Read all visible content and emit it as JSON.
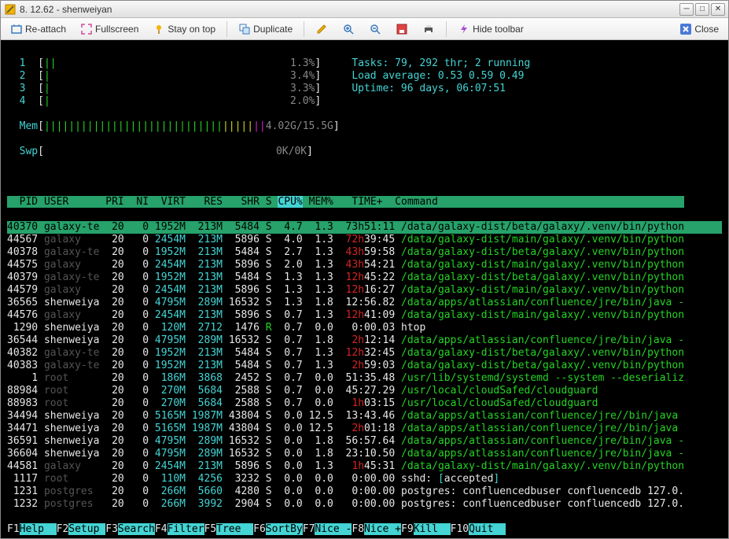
{
  "window": {
    "title": "8. 12.62 - shenweiyan"
  },
  "toolbar": {
    "reattach": "Re-attach",
    "fullscreen": "Fullscreen",
    "stayontop": "Stay on top",
    "duplicate": "Duplicate",
    "hide": "Hide toolbar",
    "close": "Close"
  },
  "cpus": [
    {
      "id": "1",
      "pct": "1.3%"
    },
    {
      "id": "2",
      "pct": "3.4%"
    },
    {
      "id": "3",
      "pct": "3.3%"
    },
    {
      "id": "4",
      "pct": "2.0%"
    }
  ],
  "mem": {
    "label": "Mem",
    "text": "4.02G/15.5G"
  },
  "swp": {
    "label": "Swp",
    "text": "0K/0K"
  },
  "sysinfo": {
    "tasks": "Tasks: 79, 292 thr; 2 running",
    "load": "Load average: 0.53 0.59 0.49",
    "uptime": "Uptime: 96 days, 06:07:51"
  },
  "header": {
    "pid": "PID",
    "user": "USER",
    "pri": "PRI",
    "ni": "NI",
    "virt": "VIRT",
    "res": "RES",
    "shr": "SHR",
    "s": "S",
    "cpu": "CPU%",
    "mem": "MEM%",
    "time": "TIME+",
    "cmd": "Command"
  },
  "rows": [
    {
      "pid": "40370",
      "user": "galaxy-te",
      "uc": "white",
      "pri": "20",
      "ni": "0",
      "virt": "1952M",
      "res": "213M",
      "shr": "5484",
      "s": "S",
      "cpu": "4.7",
      "mem": "1.3",
      "t1": "73h",
      "t2": "51:11",
      "cmd": "/data/galaxy-dist/beta/galaxy/.venv/bin/python",
      "sel": true
    },
    {
      "pid": "44567",
      "user": "galaxy",
      "uc": "dimgrey",
      "pri": "20",
      "ni": "0",
      "virt": "2454M",
      "res": "213M",
      "shr": "5896",
      "s": "S",
      "cpu": "4.0",
      "mem": "1.3",
      "t1": "72h",
      "t2": "39:45",
      "tc": "red",
      "cmd": "/data/galaxy-dist/main/galaxy/.venv/bin/python"
    },
    {
      "pid": "40378",
      "user": "galaxy-te",
      "uc": "dimgrey",
      "pri": "20",
      "ni": "0",
      "virt": "1952M",
      "res": "213M",
      "shr": "5484",
      "s": "S",
      "cpu": "2.7",
      "mem": "1.3",
      "t1": "43h",
      "t2": "59:58",
      "tc": "red",
      "cmd": "/data/galaxy-dist/beta/galaxy/.venv/bin/python"
    },
    {
      "pid": "44575",
      "user": "galaxy",
      "uc": "dimgrey",
      "pri": "20",
      "ni": "0",
      "virt": "2454M",
      "res": "213M",
      "shr": "5896",
      "s": "S",
      "cpu": "2.0",
      "mem": "1.3",
      "t1": "43h",
      "t2": "54:21",
      "tc": "red",
      "cmd": "/data/galaxy-dist/main/galaxy/.venv/bin/python"
    },
    {
      "pid": "40379",
      "user": "galaxy-te",
      "uc": "dimgrey",
      "pri": "20",
      "ni": "0",
      "virt": "1952M",
      "res": "213M",
      "shr": "5484",
      "s": "S",
      "cpu": "1.3",
      "mem": "1.3",
      "t1": "12h",
      "t2": "45:22",
      "tc": "red",
      "cmd": "/data/galaxy-dist/beta/galaxy/.venv/bin/python"
    },
    {
      "pid": "44579",
      "user": "galaxy",
      "uc": "dimgrey",
      "pri": "20",
      "ni": "0",
      "virt": "2454M",
      "res": "213M",
      "shr": "5896",
      "s": "S",
      "cpu": "1.3",
      "mem": "1.3",
      "t1": "12h",
      "t2": "16:27",
      "tc": "red",
      "cmd": "/data/galaxy-dist/main/galaxy/.venv/bin/python"
    },
    {
      "pid": "36565",
      "user": "shenweiya",
      "uc": "white",
      "pri": "20",
      "ni": "0",
      "virt": "4795M",
      "res": "289M",
      "shr": "16532",
      "s": "S",
      "cpu": "1.3",
      "mem": "1.8",
      "t1": "",
      "t2": "12:56.82",
      "cmd": "/data/apps/atlassian/confluence/jre/bin/java -"
    },
    {
      "pid": "44576",
      "user": "galaxy",
      "uc": "dimgrey",
      "pri": "20",
      "ni": "0",
      "virt": "2454M",
      "res": "213M",
      "shr": "5896",
      "s": "S",
      "cpu": "0.7",
      "mem": "1.3",
      "t1": "12h",
      "t2": "41:09",
      "tc": "red",
      "cmd": "/data/galaxy-dist/main/galaxy/.venv/bin/python"
    },
    {
      "pid": "1290",
      "user": "shenweiya",
      "uc": "white",
      "pri": "20",
      "ni": "0",
      "virt": "120M",
      "res": "2712",
      "shr": "1476",
      "s": "R",
      "sc": "green",
      "cpu": "0.7",
      "mem": "0.0",
      "t1": "",
      "t2": "0:00.03",
      "cmd": "htop",
      "cc": "white"
    },
    {
      "pid": "36544",
      "user": "shenweiya",
      "uc": "white",
      "pri": "20",
      "ni": "0",
      "virt": "4795M",
      "res": "289M",
      "shr": "16532",
      "s": "S",
      "cpu": "0.7",
      "mem": "1.8",
      "t1": "2h",
      "t2": "12:14",
      "tc": "red",
      "cmd": "/data/apps/atlassian/confluence/jre/bin/java -"
    },
    {
      "pid": "40382",
      "user": "galaxy-te",
      "uc": "dimgrey",
      "pri": "20",
      "ni": "0",
      "virt": "1952M",
      "res": "213M",
      "shr": "5484",
      "s": "S",
      "cpu": "0.7",
      "mem": "1.3",
      "t1": "12h",
      "t2": "32:45",
      "tc": "red",
      "cmd": "/data/galaxy-dist/beta/galaxy/.venv/bin/python"
    },
    {
      "pid": "40383",
      "user": "galaxy-te",
      "uc": "dimgrey",
      "pri": "20",
      "ni": "0",
      "virt": "1952M",
      "res": "213M",
      "shr": "5484",
      "s": "S",
      "cpu": "0.7",
      "mem": "1.3",
      "t1": "2h",
      "t2": "59:03",
      "tc": "red",
      "cmd": "/data/galaxy-dist/beta/galaxy/.venv/bin/python"
    },
    {
      "pid": "1",
      "user": "root",
      "uc": "dimgrey",
      "pri": "20",
      "ni": "0",
      "virt": "186M",
      "res": "3868",
      "shr": "2452",
      "s": "S",
      "cpu": "0.7",
      "mem": "0.0",
      "t1": "",
      "t2": "51:35.48",
      "cmd": "/usr/lib/systemd/systemd --system --deserializ"
    },
    {
      "pid": "88984",
      "user": "root",
      "uc": "dimgrey",
      "pri": "20",
      "ni": "0",
      "virt": "270M",
      "res": "5684",
      "shr": "2588",
      "s": "S",
      "cpu": "0.7",
      "mem": "0.0",
      "t1": "",
      "t2": "45:27.29",
      "cmd": "/usr/local/cloudSafed/cloudguard"
    },
    {
      "pid": "88983",
      "user": "root",
      "uc": "dimgrey",
      "pri": "20",
      "ni": "0",
      "virt": "270M",
      "res": "5684",
      "shr": "2588",
      "s": "S",
      "cpu": "0.7",
      "mem": "0.0",
      "t1": "1h",
      "t2": "03:15",
      "tc": "red",
      "cmd": "/usr/local/cloudSafed/cloudguard"
    },
    {
      "pid": "34494",
      "user": "shenweiya",
      "uc": "white",
      "pri": "20",
      "ni": "0",
      "virt": "5165M",
      "res": "1987M",
      "shr": "43804",
      "s": "S",
      "cpu": "0.0",
      "mem": "12.5",
      "t1": "",
      "t2": "13:43.46",
      "cmd": "/data/apps/atlassian/confluence/jre//bin/java"
    },
    {
      "pid": "34471",
      "user": "shenweiya",
      "uc": "white",
      "pri": "20",
      "ni": "0",
      "virt": "5165M",
      "res": "1987M",
      "shr": "43804",
      "s": "S",
      "cpu": "0.0",
      "mem": "12.5",
      "t1": "2h",
      "t2": "01:18",
      "tc": "red",
      "cmd": "/data/apps/atlassian/confluence/jre//bin/java"
    },
    {
      "pid": "36591",
      "user": "shenweiya",
      "uc": "white",
      "pri": "20",
      "ni": "0",
      "virt": "4795M",
      "res": "289M",
      "shr": "16532",
      "s": "S",
      "cpu": "0.0",
      "mem": "1.8",
      "t1": "",
      "t2": "56:57.64",
      "cmd": "/data/apps/atlassian/confluence/jre/bin/java -"
    },
    {
      "pid": "36604",
      "user": "shenweiya",
      "uc": "white",
      "pri": "20",
      "ni": "0",
      "virt": "4795M",
      "res": "289M",
      "shr": "16532",
      "s": "S",
      "cpu": "0.0",
      "mem": "1.8",
      "t1": "",
      "t2": "23:10.50",
      "cmd": "/data/apps/atlassian/confluence/jre/bin/java -"
    },
    {
      "pid": "44581",
      "user": "galaxy",
      "uc": "dimgrey",
      "pri": "20",
      "ni": "0",
      "virt": "2454M",
      "res": "213M",
      "shr": "5896",
      "s": "S",
      "cpu": "0.0",
      "mem": "1.3",
      "t1": "1h",
      "t2": "45:31",
      "tc": "red",
      "cmd": "/data/galaxy-dist/main/galaxy/.venv/bin/python"
    },
    {
      "pid": "1117",
      "user": "root",
      "uc": "dimgrey",
      "pri": "20",
      "ni": "0",
      "virt": "110M",
      "res": "4256",
      "shr": "3232",
      "s": "S",
      "cpu": "0.0",
      "mem": "0.0",
      "t1": "",
      "t2": "0:00.00",
      "cmdraw": "sshd: [accepted]"
    },
    {
      "pid": "1231",
      "user": "postgres",
      "uc": "dimgrey",
      "pri": "20",
      "ni": "0",
      "virt": "266M",
      "res": "5660",
      "shr": "4280",
      "s": "S",
      "cpu": "0.0",
      "mem": "0.0",
      "t1": "",
      "t2": "0:00.00",
      "cmdraw": "postgres: confluencedbuser confluencedb 127.0."
    },
    {
      "pid": "1232",
      "user": "postgres",
      "uc": "dimgrey",
      "pri": "20",
      "ni": "0",
      "virt": "266M",
      "res": "3992",
      "shr": "2904",
      "s": "S",
      "cpu": "0.0",
      "mem": "0.0",
      "t1": "",
      "t2": "0:00.00",
      "cmdraw": "postgres: confluencedbuser confluencedb 127.0."
    }
  ],
  "fkeys": [
    {
      "k": "F1",
      "l": "Help  "
    },
    {
      "k": "F2",
      "l": "Setup "
    },
    {
      "k": "F3",
      "l": "Search"
    },
    {
      "k": "F4",
      "l": "Filter"
    },
    {
      "k": "F5",
      "l": "Tree  "
    },
    {
      "k": "F6",
      "l": "SortBy"
    },
    {
      "k": "F7",
      "l": "Nice -"
    },
    {
      "k": "F8",
      "l": "Nice +"
    },
    {
      "k": "F9",
      "l": "Kill  "
    },
    {
      "k": "F10",
      "l": "Quit  "
    }
  ]
}
